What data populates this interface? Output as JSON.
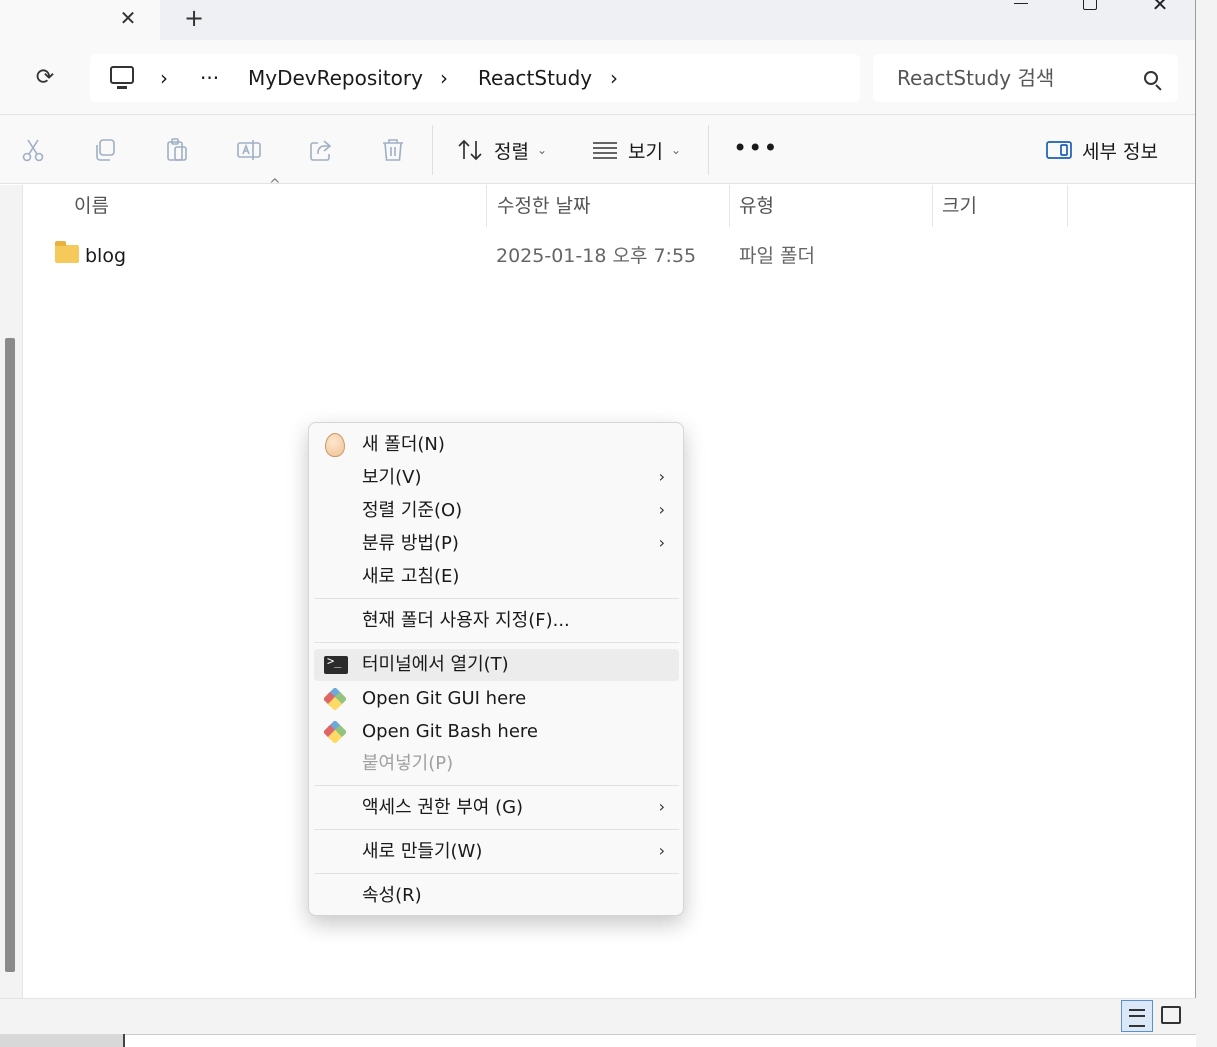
{
  "titlebar": {
    "close_tab_glyph": "✕",
    "new_tab_glyph": "+",
    "close_window_glyph": "✕"
  },
  "address": {
    "overflow": "···",
    "crumbs": [
      "MyDevRepository",
      "ReactStudy"
    ],
    "chevron": "›",
    "refresh_glyph": "⟳"
  },
  "search": {
    "placeholder": "ReactStudy 검색"
  },
  "toolbar": {
    "sort_label": "정렬",
    "view_label": "보기",
    "more_glyph": "•••",
    "details_label": "세부 정보",
    "dropdown_glyph": "⌄"
  },
  "columns": {
    "name": "이름",
    "date": "수정한 날짜",
    "type": "유형",
    "size": "크기",
    "sort_glyph": "^"
  },
  "files": [
    {
      "name": "blog",
      "date": "2025-01-18 오후 7:55",
      "type": "파일 폴더"
    }
  ],
  "context_menu": {
    "items": [
      {
        "label": "새 폴더(N)"
      },
      {
        "label": "보기(V)",
        "submenu": "›"
      },
      {
        "label": "정렬 기준(O)",
        "submenu": "›"
      },
      {
        "label": "분류 방법(P)",
        "submenu": "›"
      },
      {
        "label": "새로 고침(E)"
      },
      {
        "label": "현재 폴더 사용자 지정(F)..."
      },
      {
        "label": "터미널에서 열기(T)"
      },
      {
        "label": "Open Git GUI here"
      },
      {
        "label": "Open Git Bash here"
      },
      {
        "label": "붙여넣기(P)"
      },
      {
        "label": "액세스 권한 부여 (G)",
        "submenu": "›"
      },
      {
        "label": "새로 만들기(W)",
        "submenu": "›"
      },
      {
        "label": "속성(R)"
      }
    ]
  },
  "colors": {
    "highlight": "#ececec",
    "folder": "#f6c95b",
    "accent": "#5b8ed6"
  }
}
